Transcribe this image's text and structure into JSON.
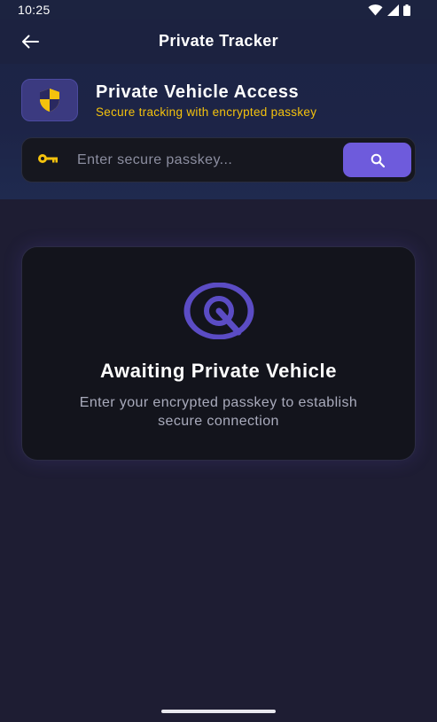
{
  "status_bar": {
    "time": "10:25",
    "icons": [
      "wifi-icon",
      "signal-icon",
      "battery-icon"
    ]
  },
  "app_bar": {
    "title": "Private Tracker",
    "back_icon": "arrow-left-icon"
  },
  "hero": {
    "icon": "shield-icon",
    "title": "Private Vehicle Access",
    "subtitle": "Secure tracking with encrypted passkey"
  },
  "search": {
    "icon": "key-icon",
    "value": "",
    "placeholder": "Enter secure passkey...",
    "button_icon": "search-icon"
  },
  "status_card": {
    "icon": "radar-icon",
    "title": "Awaiting Private Vehicle",
    "description": "Enter your encrypted passkey to establish secure connection"
  },
  "colors": {
    "accent": "#6e5bdc",
    "warning": "#f4c20d",
    "background": "#1e1d33",
    "card": "#13141c"
  }
}
